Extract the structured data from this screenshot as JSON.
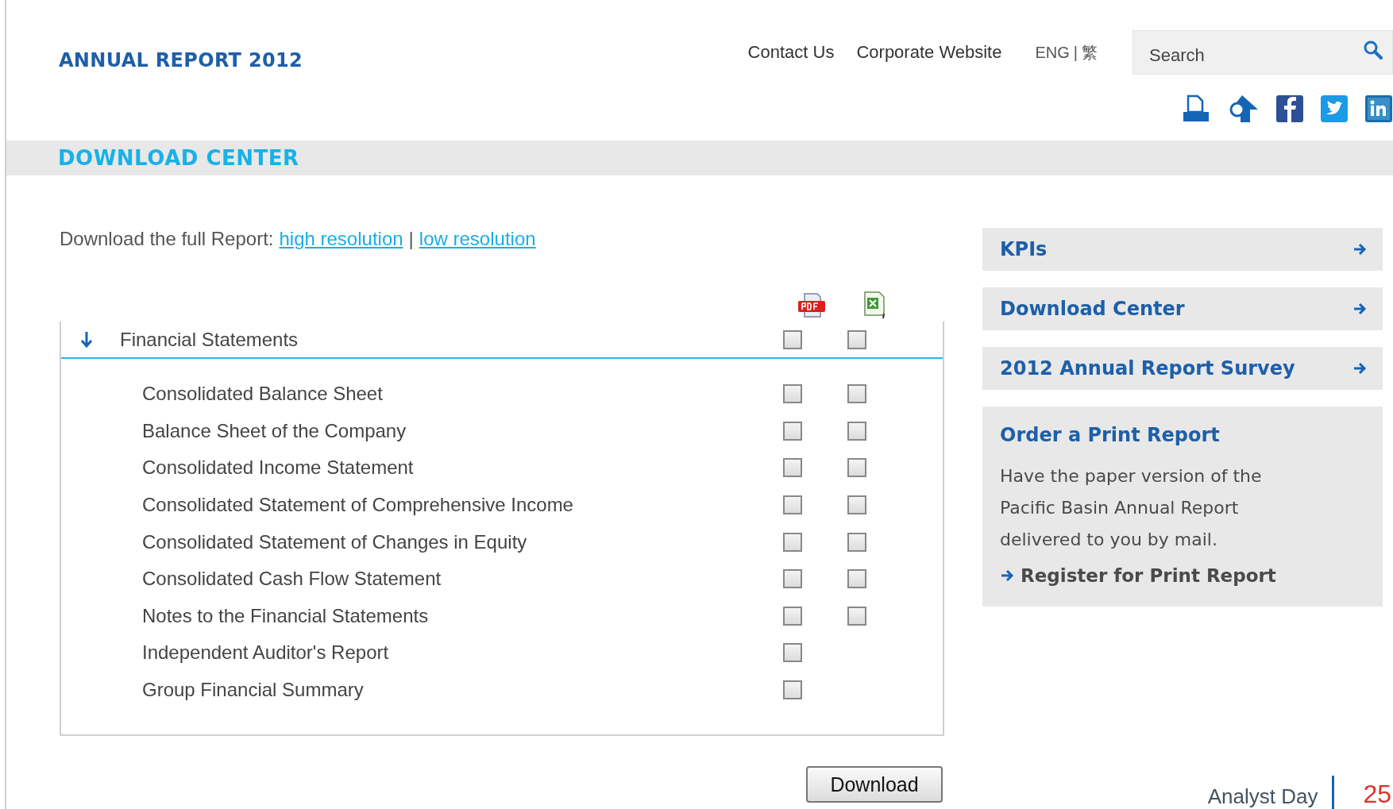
{
  "header": {
    "title": "ANNUAL REPORT 2012",
    "nav": [
      "Contact Us",
      "Corporate Website"
    ],
    "languages": [
      "ENG",
      "繁"
    ],
    "language_separator": "|",
    "search": {
      "placeholder": "Search"
    }
  },
  "section_title": "DOWNLOAD CENTER",
  "download_full": {
    "label": "Download the full Report:",
    "links": [
      "high resolution",
      "low resolution"
    ],
    "separator": "|"
  },
  "group": {
    "label": "Financial Statements",
    "expanded": true,
    "pdf_checked": false,
    "excel_checked": false,
    "items": [
      {
        "label": "Consolidated Balance Sheet",
        "pdf_checked": false,
        "excel_checked": false
      },
      {
        "label": "Balance Sheet of the Company",
        "pdf_checked": false,
        "excel_checked": false
      },
      {
        "label": "Consolidated Income Statement",
        "pdf_checked": false,
        "excel_checked": false
      },
      {
        "label": "Consolidated Statement of Comprehensive Income",
        "pdf_checked": false,
        "excel_checked": false
      },
      {
        "label": "Consolidated Statement of Changes in Equity",
        "pdf_checked": false,
        "excel_checked": false
      },
      {
        "label": "Consolidated Cash Flow Statement",
        "pdf_checked": false,
        "excel_checked": false
      },
      {
        "label": "Notes to the Financial Statements",
        "pdf_checked": false,
        "excel_checked": false
      },
      {
        "label": "Independent Auditor's Report",
        "pdf_checked": false
      },
      {
        "label": "Group Financial Summary",
        "pdf_checked": false
      }
    ]
  },
  "download_button": "Download",
  "sidebar": {
    "links": [
      "KPIs",
      "Download Center",
      "2012 Annual Report Survey"
    ],
    "order": {
      "title": "Order a Print Report",
      "text": "Have the paper version of the Pacific Basin Annual Report delivered to you by mail.",
      "link": "Register for Print Report"
    }
  },
  "footer": {
    "label": "Analyst Day",
    "page": "25"
  }
}
